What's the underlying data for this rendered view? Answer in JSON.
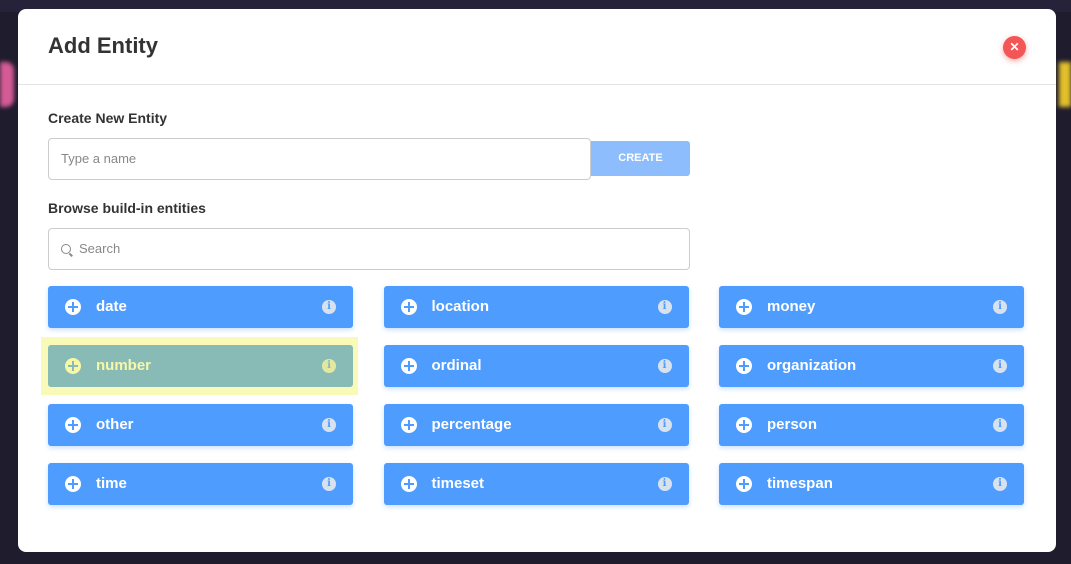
{
  "modal": {
    "title": "Add Entity",
    "close_icon": "close-icon",
    "accent_color": "#4f9cff",
    "close_color": "#f25656"
  },
  "create": {
    "label": "Create New Entity",
    "placeholder": "Type a name",
    "button": "CREATE"
  },
  "browse": {
    "label": "Browse build-in entities",
    "search_placeholder": "Search"
  },
  "entities": [
    {
      "name": "date",
      "selected": false
    },
    {
      "name": "location",
      "selected": false
    },
    {
      "name": "money",
      "selected": false
    },
    {
      "name": "number",
      "selected": true
    },
    {
      "name": "ordinal",
      "selected": false
    },
    {
      "name": "organization",
      "selected": false
    },
    {
      "name": "other",
      "selected": false
    },
    {
      "name": "percentage",
      "selected": false
    },
    {
      "name": "person",
      "selected": false
    },
    {
      "name": "time",
      "selected": false
    },
    {
      "name": "timeset",
      "selected": false
    },
    {
      "name": "timespan",
      "selected": false
    }
  ]
}
